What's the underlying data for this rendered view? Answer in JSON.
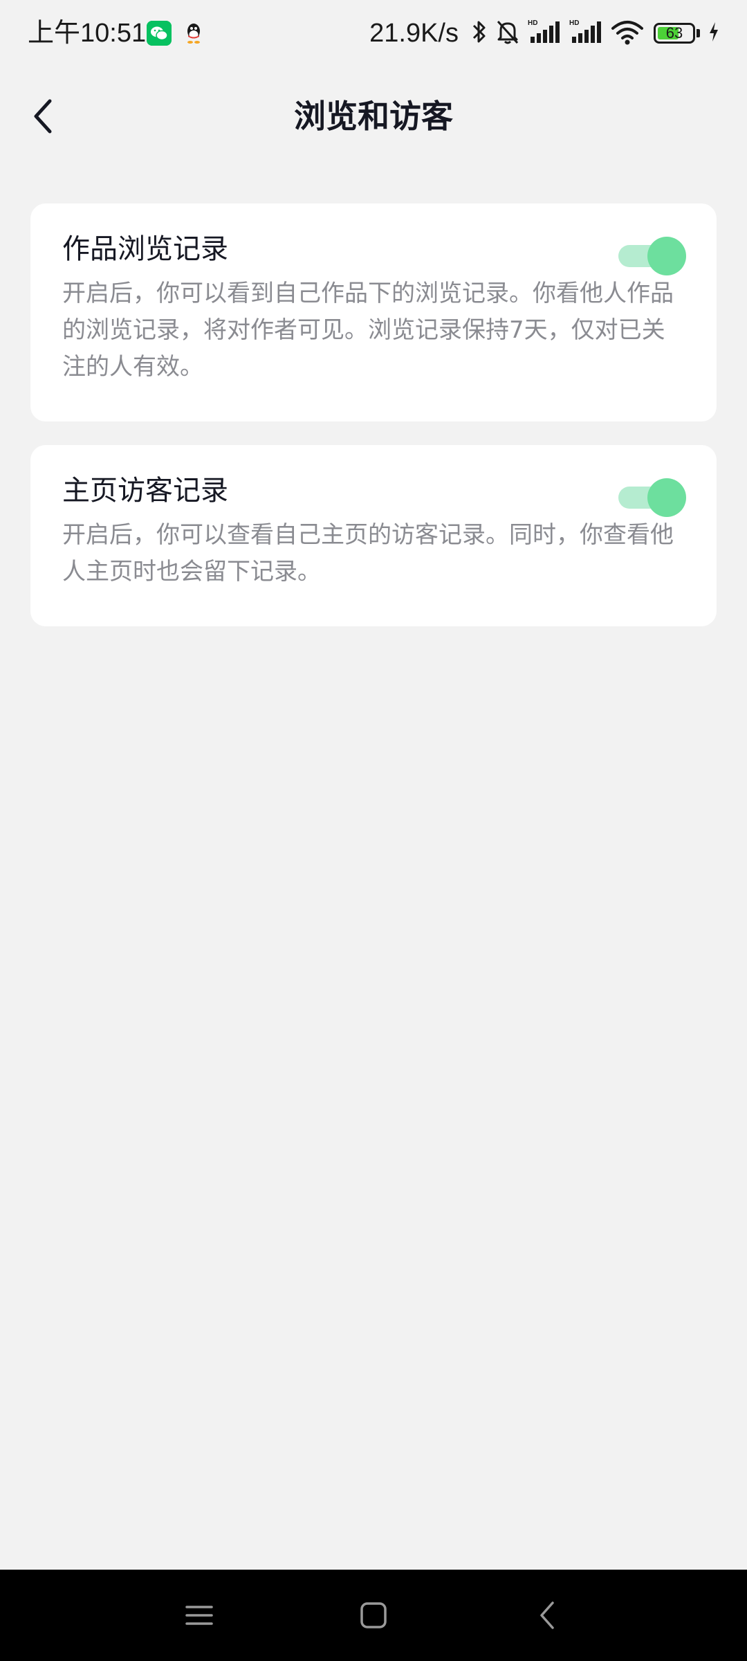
{
  "status_bar": {
    "time": "上午10:51",
    "net_speed": "21.9K/s",
    "battery_level": "63",
    "battery_percent": 63,
    "icons": [
      "wechat-icon",
      "qq-icon",
      "bluetooth-icon",
      "mute-bell-icon",
      "hd-signal-icon",
      "hd-signal-icon",
      "wifi-icon",
      "battery-icon",
      "charging-icon"
    ]
  },
  "header": {
    "title": "浏览和访客"
  },
  "settings": [
    {
      "title": "作品浏览记录",
      "description": "开启后，你可以看到自己作品下的浏览记录。你看他人作品的浏览记录，将对作者可见。浏览记录保持7天，仅对已关注的人有效。",
      "enabled": true
    },
    {
      "title": "主页访客记录",
      "description": "开启后，你可以查看自己主页的访客记录。同时，你查看他人主页时也会留下记录。",
      "enabled": true
    }
  ],
  "colors": {
    "background": "#f2f2f2",
    "card": "#ffffff",
    "toggle_track": "#b5ecd0",
    "toggle_thumb": "#6ddf9e",
    "description_text": "#8a8b91",
    "nav_bar": "#000000"
  }
}
